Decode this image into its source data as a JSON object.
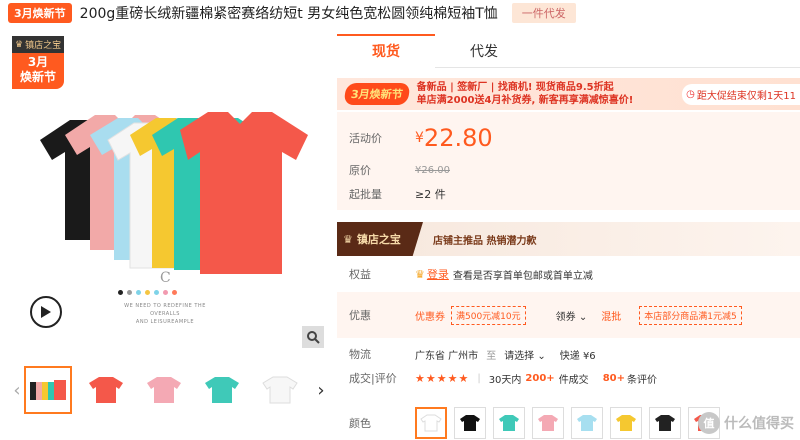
{
  "header": {
    "festival_tag": "3月焕新节",
    "product_title": "200g重磅长绒新疆棉紧密赛络纺短t 男女纯色宽松圆领纯棉短袖T恤",
    "dropship_badge": "一件代发"
  },
  "gallery": {
    "store_badge_top": "镇店之宝",
    "store_badge_bottom_line1": "3月",
    "store_badge_bottom_line2": "焕新节",
    "brand_mark": "C",
    "slogan_line1": "WE NEED TO REDEFINE THE OVERALLS",
    "slogan_line2": "AND LEISUREAMPLE",
    "dot_colors": [
      "#222222",
      "#999999",
      "#7fd3e8",
      "#f5c542",
      "#7fd3e8",
      "#f29ab0",
      "#ff7a5a"
    ],
    "thumbnails": [
      {
        "name": "multi",
        "active": true
      },
      {
        "name": "red",
        "color": "#f4584a"
      },
      {
        "name": "pink",
        "color": "#f4a9b4"
      },
      {
        "name": "teal",
        "color": "#3fc9b8"
      },
      {
        "name": "white",
        "color": "#f5f5f5"
      }
    ]
  },
  "tabs": [
    {
      "label": "现货",
      "active": true
    },
    {
      "label": "代发",
      "active": false
    }
  ],
  "promo": {
    "tag": "3月焕新节",
    "line1": "备新品 | 签新厂 | 找商机!   现货商品9.5折起",
    "line2": "单店满2000送4月补货券, 新客再享满减惊喜价!",
    "countdown": "距大促结束仅剩1天11"
  },
  "pricing": {
    "active_label": "活动价",
    "currency": "¥",
    "active_price": "22.80",
    "original_label": "原价",
    "original_price": "¥26.00",
    "min_order_label": "起批量",
    "min_order": "≥2 件"
  },
  "treasure": {
    "logo": "镇店之宝",
    "text": "店铺主推品   热销潜力款"
  },
  "benefits": {
    "label": "权益",
    "tag": "登录",
    "text": "查看是否享首单包邮或首单立减"
  },
  "offers": {
    "label": "优惠",
    "coupon_label": "优惠券",
    "coupon": "满500元减10元",
    "get_coupon": "领券",
    "mixed": "混批",
    "store_rule": "本店部分商品满1元减5"
  },
  "logistics": {
    "label": "物流",
    "origin": "广东省 广州市",
    "to": "至",
    "dest": "请选择",
    "express": "快递 ¥6"
  },
  "deals": {
    "label": "成交|评价",
    "stars": "★★★★★",
    "period": "30天内",
    "count": "200+",
    "count_suffix": "件成交",
    "reviews": "80+",
    "reviews_suffix": "条评价"
  },
  "colors": {
    "label": "颜色",
    "swatches": [
      "#ffffff",
      "#111111",
      "#3fc9b8",
      "#f4a9b4",
      "#a7dff0",
      "#f5c830",
      "#222222",
      "#f4584a"
    ]
  },
  "watermark": {
    "circle": "值",
    "text": "什么值得买"
  }
}
